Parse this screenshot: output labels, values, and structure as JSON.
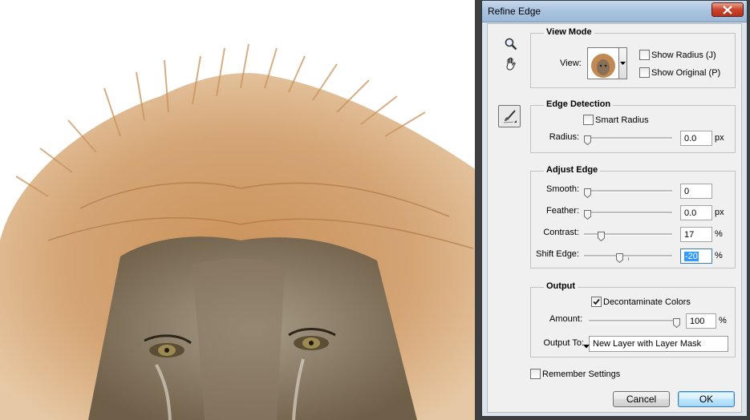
{
  "dialog": {
    "title": "Refine Edge"
  },
  "view_mode": {
    "title": "View Mode",
    "view_label": "View:",
    "show_radius": {
      "label": "Show Radius (J)",
      "checked": false
    },
    "show_original": {
      "label": "Show Original (P)",
      "checked": false
    }
  },
  "edge_detection": {
    "title": "Edge Detection",
    "smart_radius": {
      "label": "Smart Radius",
      "checked": false
    },
    "radius": {
      "label": "Radius:",
      "value": "0.0",
      "unit": "px",
      "slider_fraction": 0.0
    }
  },
  "adjust_edge": {
    "title": "Adjust Edge",
    "smooth": {
      "label": "Smooth:",
      "value": "0",
      "unit": "",
      "slider_fraction": 0.0
    },
    "feather": {
      "label": "Feather:",
      "value": "0.0",
      "unit": "px",
      "slider_fraction": 0.0
    },
    "contrast": {
      "label": "Contrast:",
      "value": "17",
      "unit": "%",
      "slider_fraction": 0.17
    },
    "shift_edge": {
      "label": "Shift Edge:",
      "value": "-20",
      "unit": "%",
      "slider_fraction": 0.4
    }
  },
  "output": {
    "title": "Output",
    "decontaminate": {
      "label": "Decontaminate Colors",
      "checked": true
    },
    "amount": {
      "label": "Amount:",
      "value": "100",
      "unit": "%",
      "slider_fraction": 1.0
    },
    "output_to": {
      "label": "Output To:",
      "selected": "New Layer with Layer Mask"
    }
  },
  "remember_settings": {
    "label": "Remember Settings",
    "checked": false
  },
  "buttons": {
    "cancel": "Cancel",
    "ok": "OK"
  },
  "icons": {
    "zoom": "magnifier-icon",
    "hand": "hand-icon",
    "brush": "refine-radius-brush-icon",
    "close": "close-icon",
    "dropdown": "chevron-down-icon"
  },
  "colors": {
    "titlebar": "#aac4e0",
    "close_button": "#c9442b",
    "default_button": "#bee6fd",
    "selection": "#3399ff"
  }
}
